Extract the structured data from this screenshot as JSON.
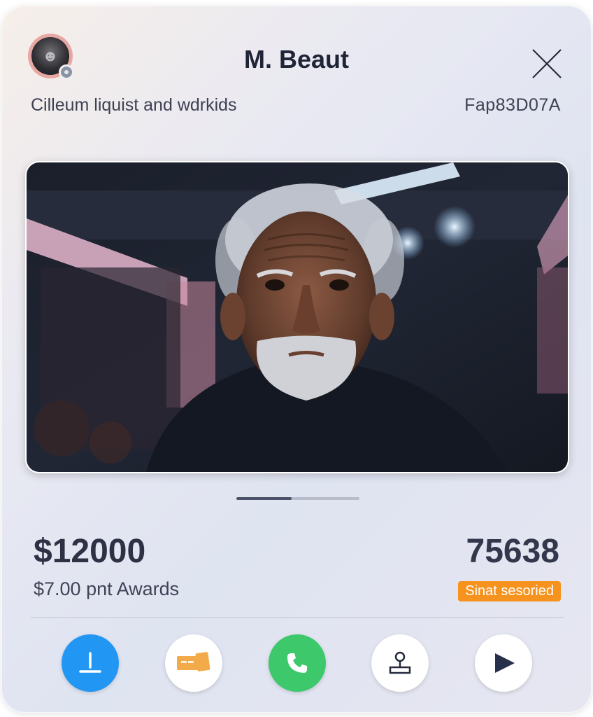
{
  "header": {
    "title": "M. Beaut",
    "subtitle": "Cilleum liquist and wdrkids",
    "code": "Fap83D07A"
  },
  "media": {
    "progress": 0.45
  },
  "stats": {
    "price": "$12000",
    "price_sub": "$7.00 pnt Awards",
    "count": "75638",
    "badge": "Sinat sesoried"
  },
  "actions": [
    {
      "icon": "download-icon",
      "color": "#2196f3"
    },
    {
      "icon": "ticket-icon",
      "color": "#f3ab4a"
    },
    {
      "icon": "phone-icon",
      "color": "#3cc86b"
    },
    {
      "icon": "joystick-icon",
      "color": "#222a3c"
    },
    {
      "icon": "play-icon",
      "color": "#26304a"
    }
  ]
}
